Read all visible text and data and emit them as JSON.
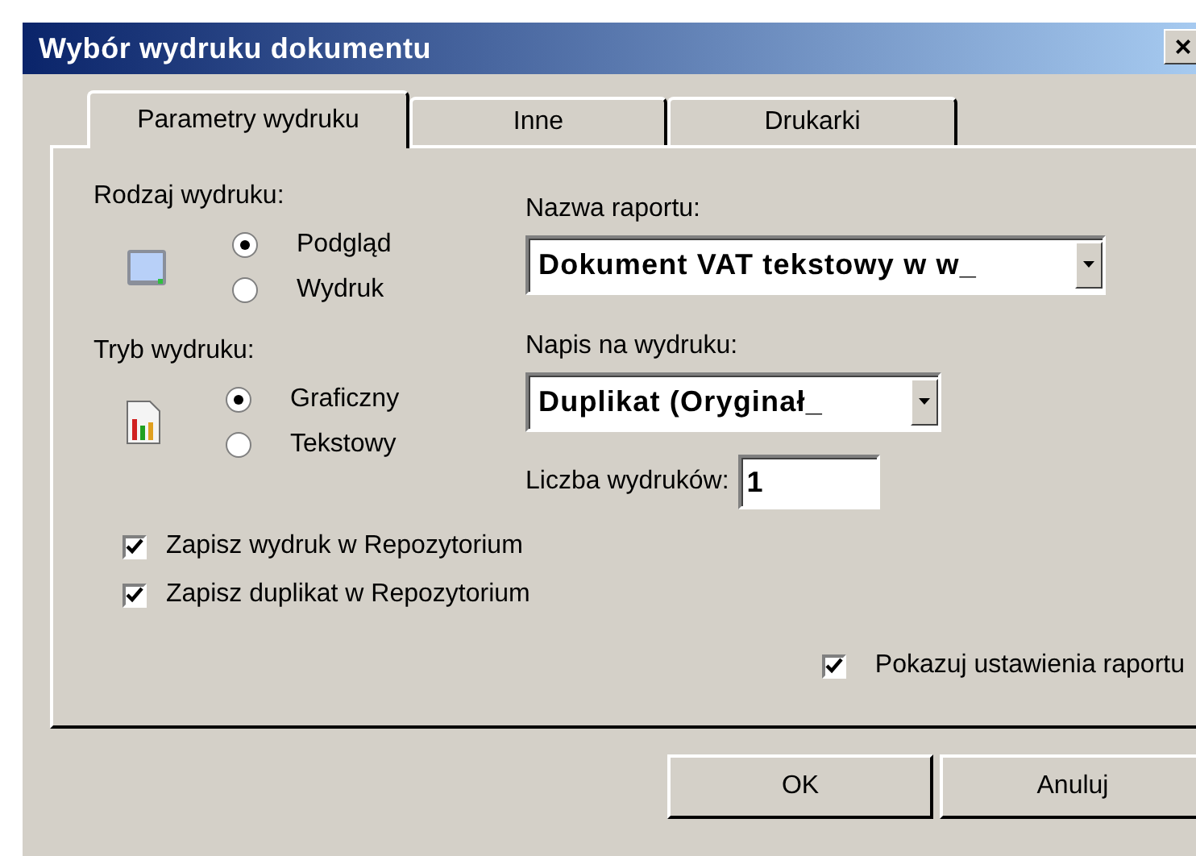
{
  "window": {
    "title": "Wybór wydruku dokumentu",
    "close": "×"
  },
  "tabs": [
    {
      "label": "Parametry wydruku",
      "selected": true
    },
    {
      "label": "Inne",
      "selected": false
    },
    {
      "label": "Drukarki",
      "selected": false
    }
  ],
  "print_type": {
    "label": "Rodzaj wydruku:",
    "options": [
      {
        "label": "Podgląd",
        "selected": true
      },
      {
        "label": "Wydruk",
        "selected": false
      }
    ]
  },
  "print_mode": {
    "label": "Tryb wydruku:",
    "options": [
      {
        "label": "Graficzny",
        "selected": true
      },
      {
        "label": "Tekstowy",
        "selected": false
      }
    ]
  },
  "report_name": {
    "label": "Nazwa raportu:",
    "value": "Dokument VAT tekstowy w w_"
  },
  "print_caption": {
    "label": "Napis na wydruku:",
    "value": "Duplikat (Oryginał_"
  },
  "copies": {
    "label": "Liczba wydruków:",
    "value": "1"
  },
  "checkboxes": [
    {
      "label": "Zapisz wydruk w Repozytorium",
      "checked": true
    },
    {
      "label": "Zapisz duplikat w Repozytorium",
      "checked": true
    },
    {
      "label": "Pokazuj ustawienia raportu",
      "checked": true
    }
  ],
  "buttons": [
    "OK",
    "Anuluj"
  ]
}
